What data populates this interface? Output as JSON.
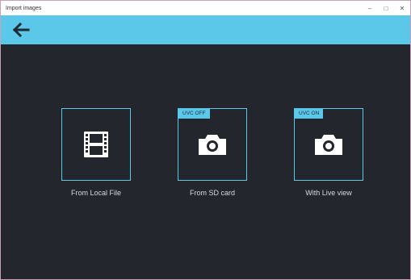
{
  "window": {
    "title": "Import images",
    "controls": {
      "minimize": "–",
      "maximize": "□",
      "close": "✕"
    }
  },
  "toolbar": {
    "back_icon": "arrow-left-icon"
  },
  "options": [
    {
      "label": "From Local File",
      "icon": "film-icon",
      "badge": ""
    },
    {
      "label": "From SD card",
      "icon": "camera-icon",
      "badge": "UVC OFF"
    },
    {
      "label": "With Live view",
      "icon": "camera-icon",
      "badge": "UVC ON"
    }
  ],
  "colors": {
    "accent": "#5bc8ea",
    "background": "#24262d",
    "text": "#d7d9dd"
  }
}
